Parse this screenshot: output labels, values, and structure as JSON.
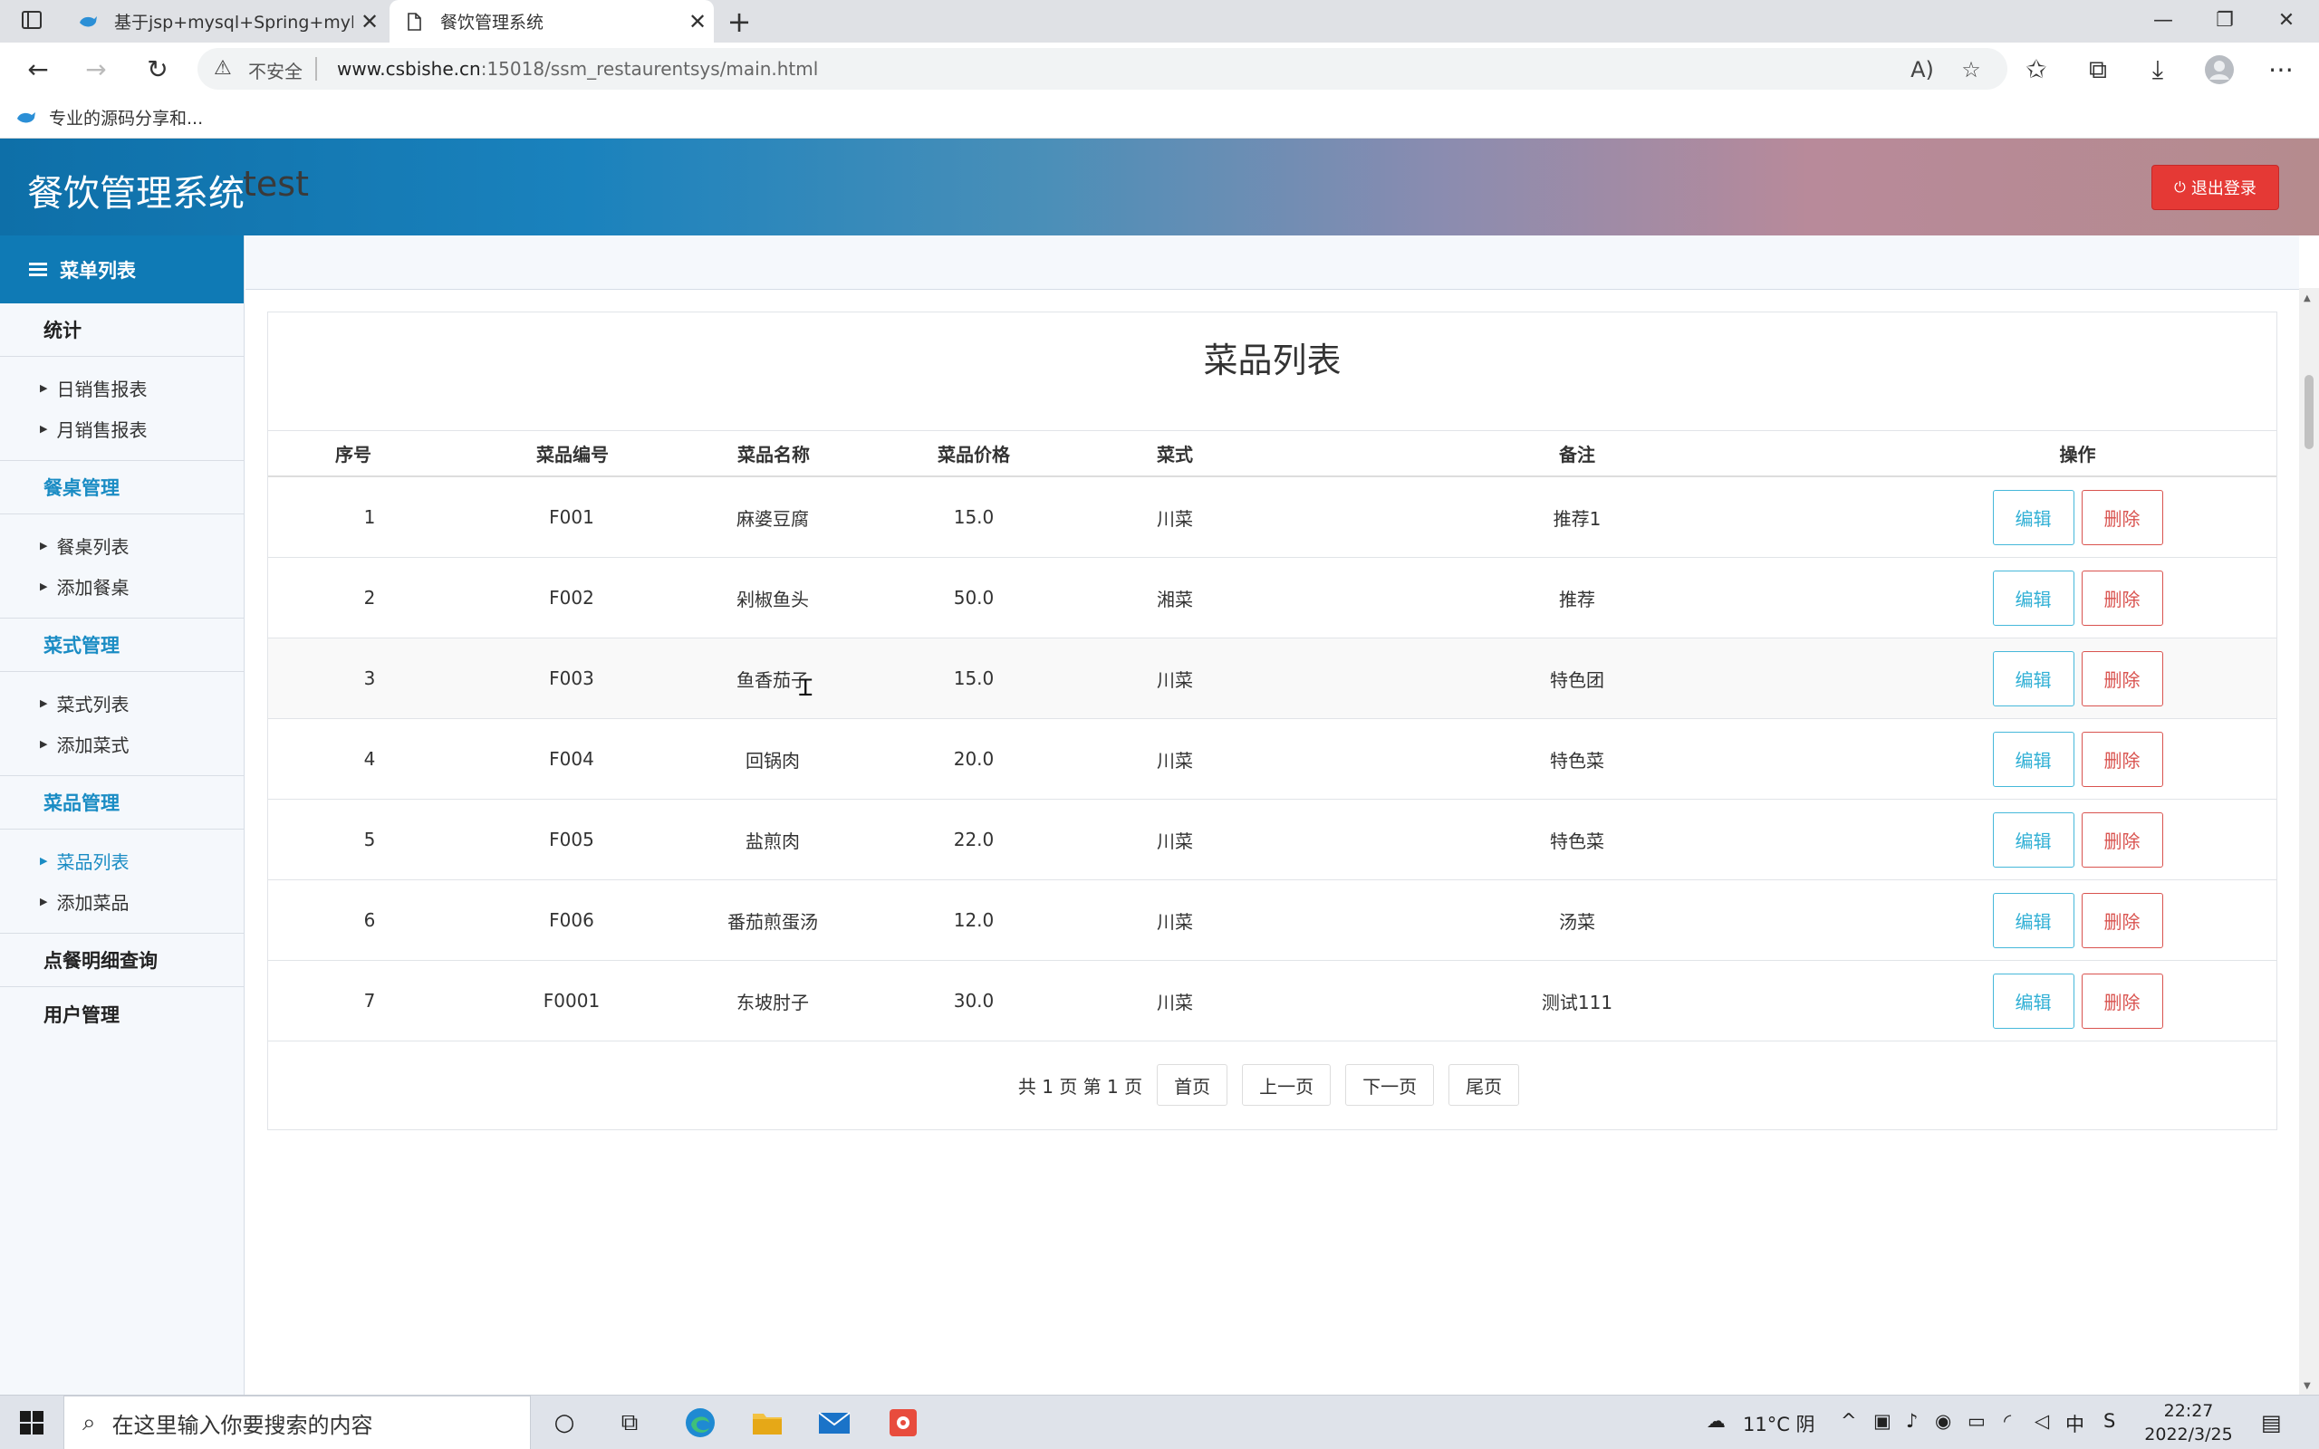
{
  "browser": {
    "tabs": [
      {
        "title": "基于jsp+mysql+Spring+mybatis",
        "close": "✕"
      },
      {
        "title": "餐饮管理系统",
        "close": "✕"
      }
    ],
    "new_tab": "+",
    "window_controls": {
      "minimize": "—",
      "restore": "❐",
      "close": "✕"
    },
    "nav": {
      "back": "←",
      "forward": "→",
      "reload": "↻"
    },
    "security_label": "不安全",
    "url_host": "www.csbishe.cn",
    "url_path": ":15018/ssm_restaurentsys/main.html",
    "bookmark": "专业的源码分享和..."
  },
  "app": {
    "brand": "餐饮管理系统",
    "user": "test",
    "logout": "退出登录"
  },
  "sidebar": {
    "header": "菜单列表",
    "groups": [
      {
        "label": "统计",
        "items": [
          "日销售报表",
          "月销售报表"
        ]
      },
      {
        "label": "餐桌管理",
        "items": [
          "餐桌列表",
          "添加餐桌"
        ]
      },
      {
        "label": "菜式管理",
        "items": [
          "菜式列表",
          "添加菜式"
        ]
      },
      {
        "label": "菜品管理",
        "items": [
          "菜品列表",
          "添加菜品"
        ]
      },
      {
        "label": "点餐明细查询",
        "items": []
      },
      {
        "label": "用户管理",
        "items": []
      }
    ]
  },
  "main": {
    "title": "菜品列表",
    "columns": [
      "序号",
      "菜品编号",
      "菜品名称",
      "菜品价格",
      "菜式",
      "备注",
      "操作"
    ],
    "rows": [
      {
        "no": "1",
        "code": "F001",
        "name": "麻婆豆腐",
        "price": "15.0",
        "style": "川菜",
        "remark": "推荐1"
      },
      {
        "no": "2",
        "code": "F002",
        "name": "剁椒鱼头",
        "price": "50.0",
        "style": "湘菜",
        "remark": "推荐"
      },
      {
        "no": "3",
        "code": "F003",
        "name": "鱼香茄子",
        "price": "15.0",
        "style": "川菜",
        "remark": "特色团"
      },
      {
        "no": "4",
        "code": "F004",
        "name": "回锅肉",
        "price": "20.0",
        "style": "川菜",
        "remark": "特色菜"
      },
      {
        "no": "5",
        "code": "F005",
        "name": "盐煎肉",
        "price": "22.0",
        "style": "川菜",
        "remark": "特色菜"
      },
      {
        "no": "6",
        "code": "F006",
        "name": "番茄煎蛋汤",
        "price": "12.0",
        "style": "川菜",
        "remark": "汤菜"
      },
      {
        "no": "7",
        "code": "F0001",
        "name": "东坡肘子",
        "price": "30.0",
        "style": "川菜",
        "remark": "测试111"
      }
    ],
    "edit_label": "编辑",
    "delete_label": "删除",
    "pager": {
      "info": "共 1 页 第 1 页",
      "first": "首页",
      "prev": "上一页",
      "next": "下一页",
      "last": "尾页"
    }
  },
  "taskbar": {
    "search_placeholder": "在这里输入你要搜索的内容",
    "weather": "11°C 阴",
    "time": "22:27",
    "date": "2022/3/25"
  }
}
